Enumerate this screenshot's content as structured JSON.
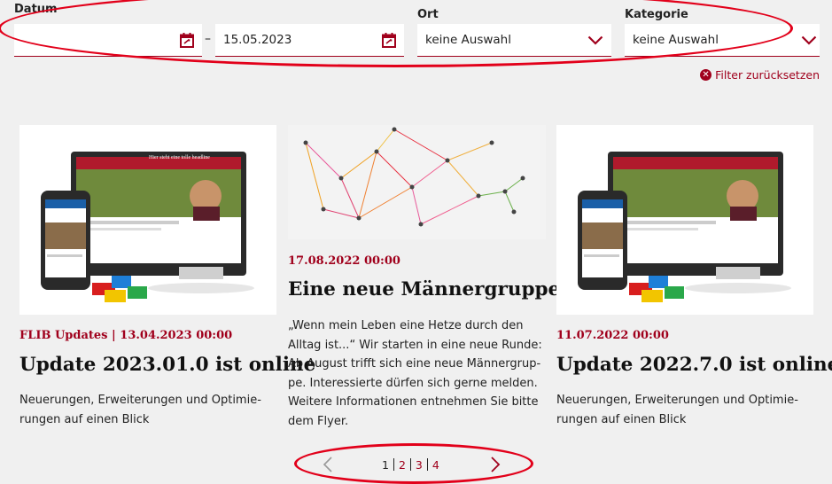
{
  "filters": {
    "date_label": "Datum",
    "date_from_value": "",
    "date_separator": "–",
    "date_to_value": "15.05.2023",
    "location_label": "Ort",
    "location_value": "keine Auswahl",
    "category_label": "Kategorie",
    "category_value": "keine Auswahl",
    "reset_label": "Filter zurücksetzen"
  },
  "cards": [
    {
      "meta": "FLIB Updates | 13.04.2023 00:00",
      "title": "Update 2023.01.0 ist online",
      "description_lines": [
        "Neuerungen, Erweiterungen und Optimie-",
        "rungen auf einen Blick"
      ],
      "mockup_text": "Hier steht eine tolle headline",
      "mockup_subline": "Headline h2"
    },
    {
      "meta": "17.08.2022 00:00",
      "title": "Eine neue Männergruppe",
      "description_lines": [
        "„Wenn mein Leben eine Hetze durch den",
        "Alltag ist...“ Wir starten in eine neue Runde:",
        "Ab August trifft sich eine neue Männergrup-",
        "pe. Interessierte dürfen sich gerne melden.",
        "Weitere Informationen entnehmen Sie bitte",
        "dem Flyer."
      ]
    },
    {
      "meta": "11.07.2022 00:00",
      "title": "Update 2022.7.0 ist online",
      "description_lines": [
        "Neuerungen, Erweiterungen und Optimie-",
        "rungen auf einen Blick"
      ],
      "mockup_text": "Hier steht eine tolle headline",
      "mockup_subline": "Headline h2"
    }
  ],
  "pagination": {
    "pages": [
      "1",
      "2",
      "3",
      "4"
    ],
    "current": "1"
  },
  "colors": {
    "accent": "#a0001c",
    "highlight_ring": "#e2001a",
    "background": "#f0f0f0"
  },
  "icons": {
    "calendar": "calendar-icon",
    "chevron": "chevron-down-icon",
    "reset": "close-circle-icon",
    "prev": "chevron-left-icon",
    "next": "chevron-right-icon"
  }
}
